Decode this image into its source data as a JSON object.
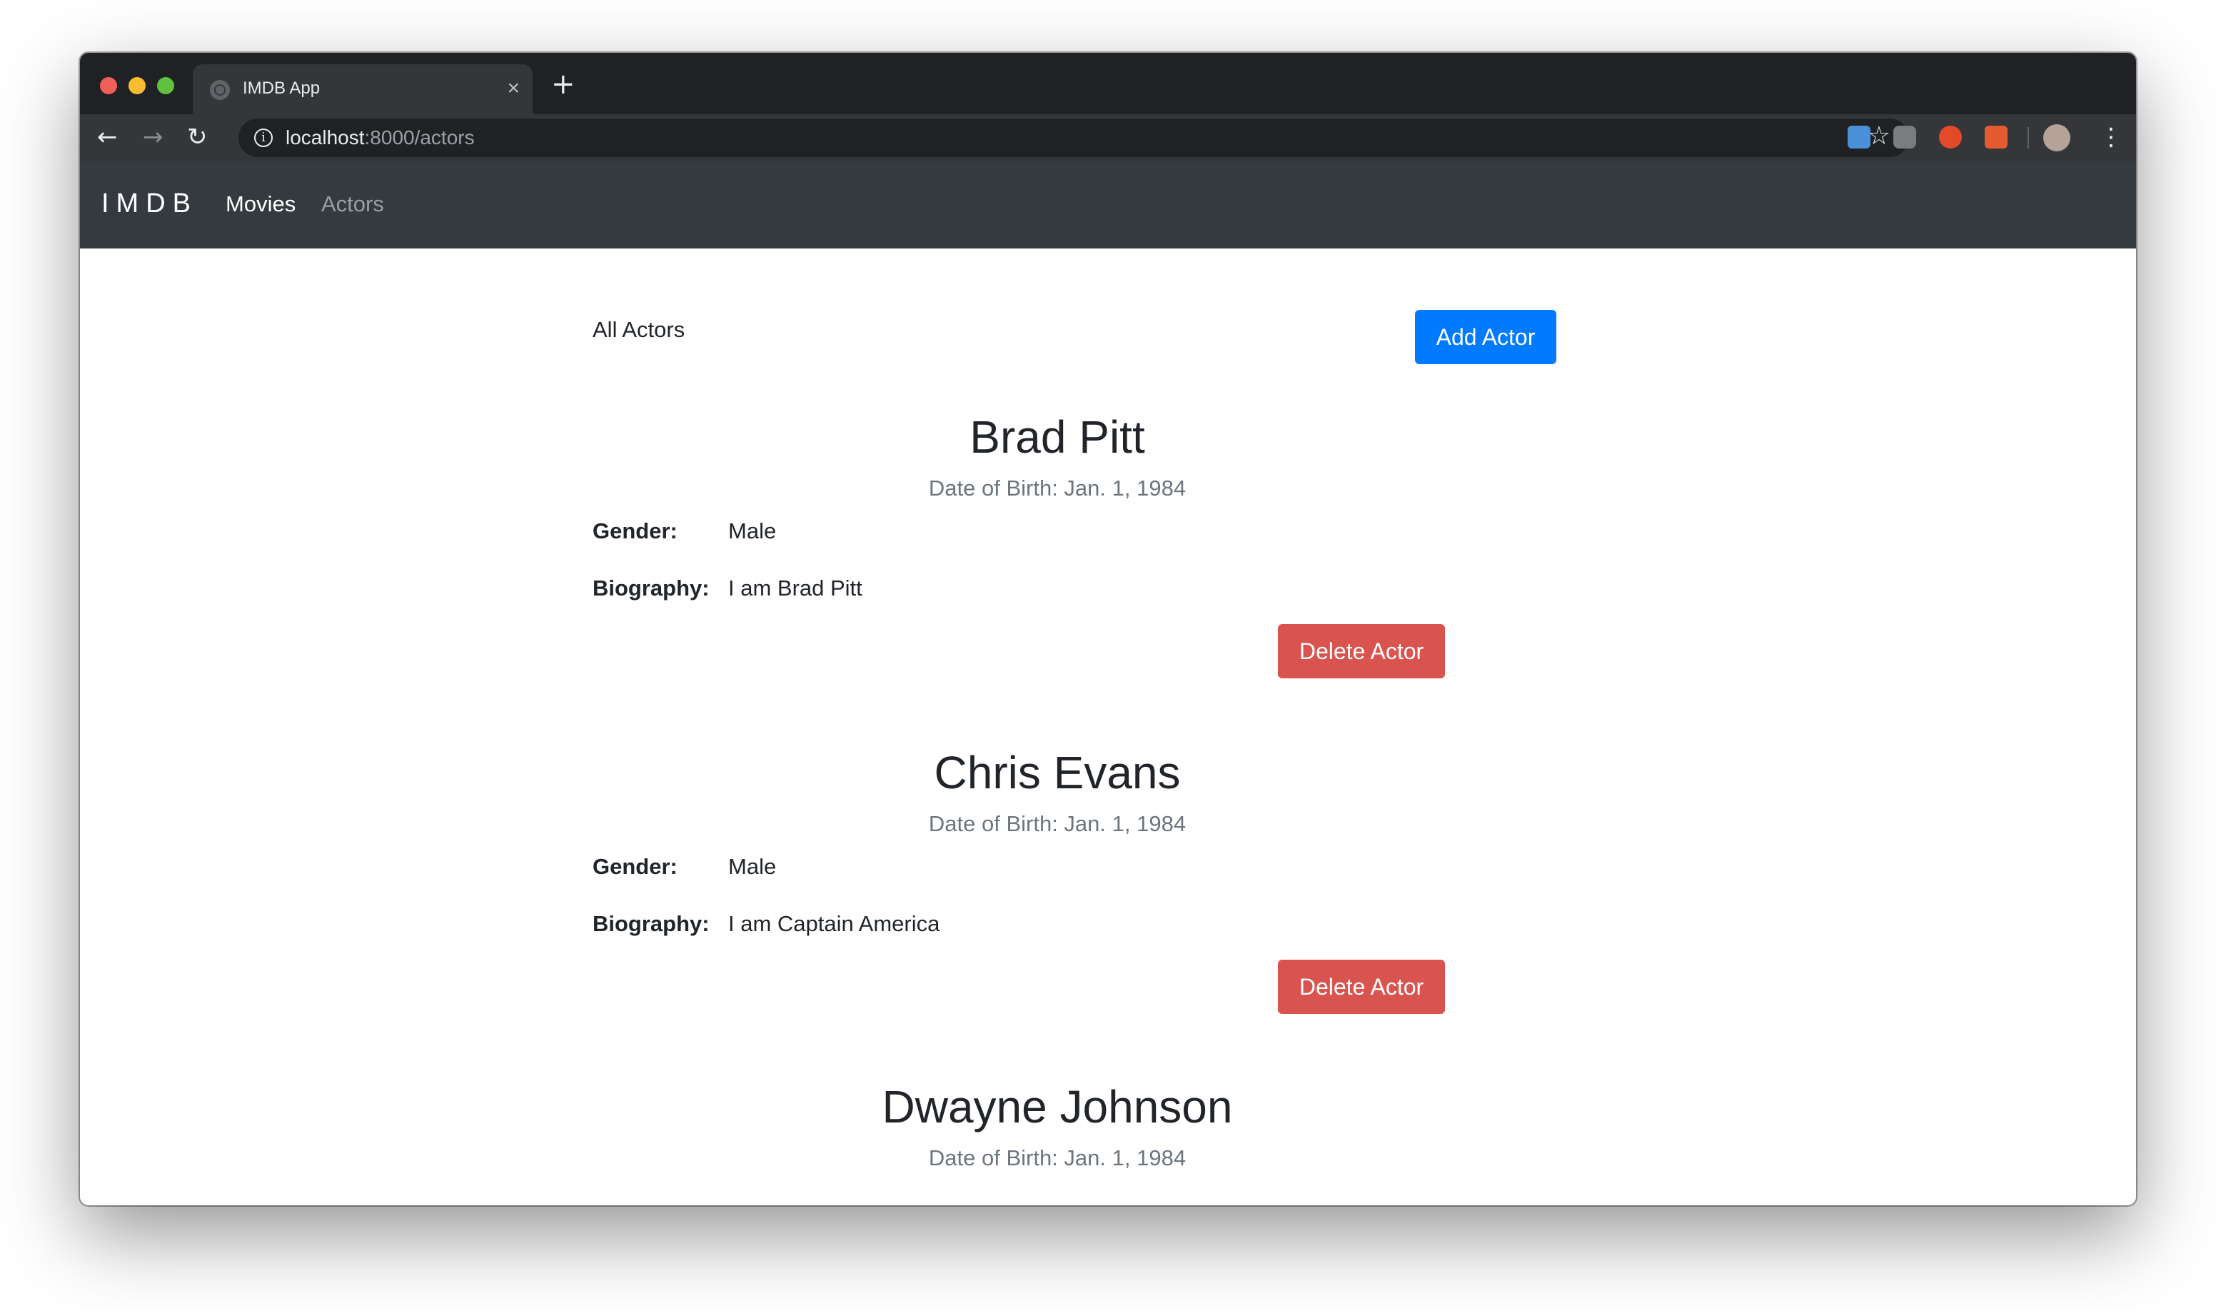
{
  "browser": {
    "tab_title": "IMDB App",
    "tab_close": "×",
    "new_tab": "+",
    "url_host": "localhost",
    "url_path": ":8000/actors",
    "back": "←",
    "forward": "→",
    "reload": "↻",
    "star": "☆",
    "menu": "⋮",
    "info": "i"
  },
  "navbar": {
    "brand": "IMDB",
    "links": [
      "Movies",
      "Actors"
    ]
  },
  "page": {
    "heading": "All Actors",
    "add_button": "Add Actor"
  },
  "actors": [
    {
      "name": "Brad Pitt",
      "dob": "Date of Birth: Jan. 1, 1984",
      "gender_label": "Gender:",
      "gender": "Male",
      "bio_label": "Biography:",
      "bio": "I am Brad Pitt",
      "delete_button": "Delete Actor"
    },
    {
      "name": "Chris Evans",
      "dob": "Date of Birth: Jan. 1, 1984",
      "gender_label": "Gender:",
      "gender": "Male",
      "bio_label": "Biography:",
      "bio": "I am Captain America",
      "delete_button": "Delete Actor"
    },
    {
      "name": "Dwayne Johnson",
      "dob": "Date of Birth: Jan. 1, 1984"
    }
  ],
  "colors": {
    "primary": "#007bff",
    "danger": "#d9534f",
    "navbar": "#343a40",
    "muted": "#6c757d"
  },
  "icons": [
    "globe-icon",
    "close-icon",
    "plus-icon",
    "back-arrow-icon",
    "forward-arrow-icon",
    "reload-icon",
    "info-icon",
    "star-icon",
    "extension-icon",
    "avatar",
    "kebab-menu-icon"
  ]
}
